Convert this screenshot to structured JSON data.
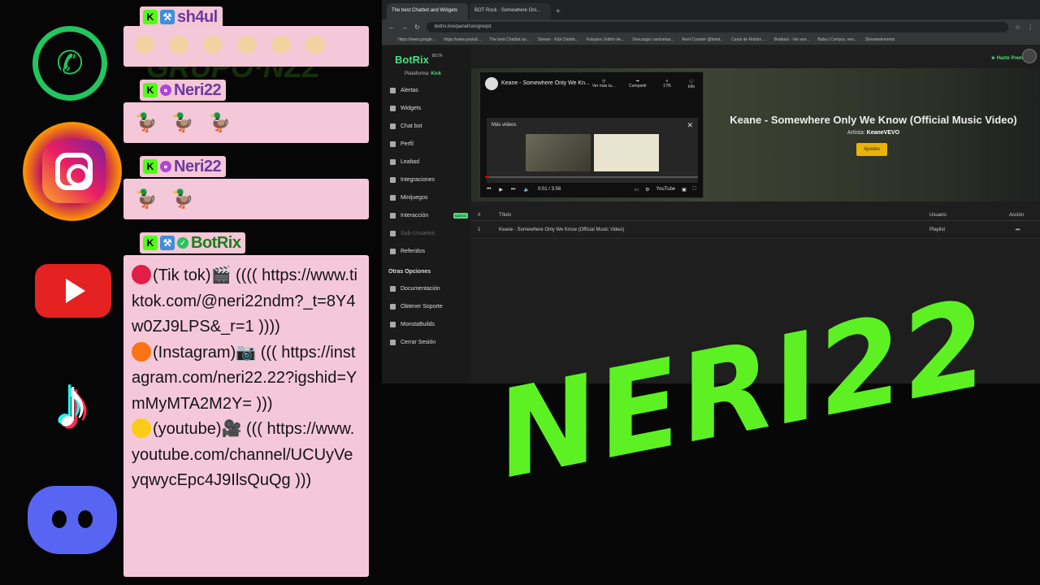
{
  "chat": {
    "messages": [
      {
        "user": "sh4ul",
        "badges": [
          "kick",
          "wrench"
        ],
        "content": "emotes",
        "emote_count": 6
      },
      {
        "user": "Neri22",
        "badges": [
          "kick",
          "mic"
        ],
        "content": "ducks",
        "emote_count": 3
      },
      {
        "user": "Neri22",
        "badges": [
          "kick",
          "mic"
        ],
        "content": "ducks",
        "emote_count": 2
      },
      {
        "user": "BotRix",
        "badges": [
          "kick",
          "wrench",
          "verified"
        ],
        "lines": [
          {
            "dot": "#e11d48",
            "label": "(Tik tok)",
            "icon": "🎬",
            "text": " (((( https://www.tiktok.com/@neri22ndm?_t=8Y4w0ZJ9LPS&_r=1 ))))"
          },
          {
            "dot": "#f97316",
            "label": "(Instagram)",
            "icon": "📷",
            "text": " ((( https://instagram.com/neri22.22?igshid=YmMyMTA2M2Y= )))"
          },
          {
            "dot": "#facc15",
            "label": "(youtube)",
            "icon": "🎥",
            "text": " ((( https://www.youtube.com/channel/UCUyVeyqwycEpc4J9IlsQuQg )))"
          }
        ]
      }
    ]
  },
  "social_icons": [
    "whatsapp-icon",
    "instagram-icon",
    "youtube-icon",
    "tiktok-icon",
    "discord-icon"
  ],
  "browser": {
    "tabs": [
      "The best Chatbot and Widgets",
      "BOT Rock · Somewhere Onl..."
    ],
    "url": "botrix.live/panel/songreqst",
    "bookmarks": [
      "https://www.google...",
      "https://www.youtub...",
      "The best Chatbot an...",
      "Stream · Kick Dashb...",
      "Fotopea | Editor de...",
      "Descargar camisetas...",
      "Rent Counter @twoit...",
      "Canal de Roblox ...",
      "Bratkast · Ver wor...",
      "Baba | Compra, ven...",
      "Streamelements"
    ],
    "app": {
      "logo": "BotRix",
      "beta": "BETA",
      "platform_label": "Plataforma:",
      "platform_value": "Kick",
      "premium": "Hazte Premium",
      "nav": [
        "Alertas",
        "Widgets",
        "Chat bot",
        "Perfil",
        "Lealtad",
        "Integraciones",
        "Minijuegos",
        "Interacción",
        "Sub-Usuarios",
        "Referidos"
      ],
      "nav_new": "NUEVO",
      "other_header": "Otras Opciones",
      "other": [
        "Documentación",
        "Obtener Soporte",
        "MonstaBuilds",
        "Cerrar Sesión"
      ],
      "player": {
        "title": "Keane - Somewhere Only We Kn...",
        "actions": [
          "Ver más ta...",
          "Compartir",
          "1?/5",
          "Info"
        ],
        "more_videos": "Más videos",
        "time": "0:01 / 3:56",
        "yt": "YouTube"
      },
      "song_title": "Keane - Somewhere Only We Know (Official Music Video)",
      "artist_label": "Artista:",
      "artist": "KeaneVEVO",
      "settings_button": "Ajustes",
      "table": {
        "headers": [
          "#",
          "Título",
          "Usuario",
          "Acción"
        ],
        "rows": [
          {
            "n": "1",
            "title": "Keane - Somewhere Only We Know (Official Music Video)",
            "user": "Playlist",
            "action": "⏭"
          }
        ]
      }
    }
  },
  "overlay_title": "NERI22",
  "colors": {
    "neon_green": "#5df123",
    "bubble_pink": "#f5c8d9",
    "kick_green": "#53fc18"
  }
}
